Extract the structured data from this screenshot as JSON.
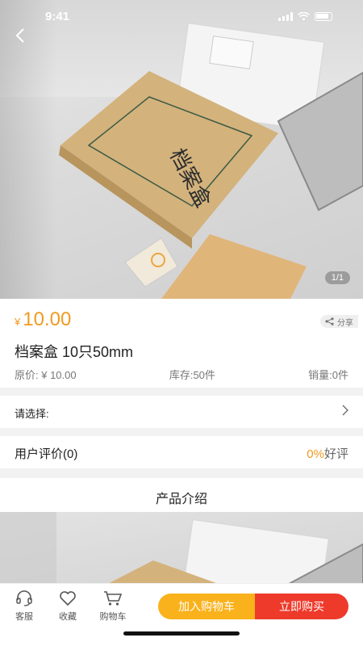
{
  "status_bar": {
    "time": "9:41"
  },
  "gallery": {
    "counter": "1/1",
    "box_label": "档案盒"
  },
  "product": {
    "currency": "¥",
    "price": "10.00",
    "share_label": "分享",
    "title": "档案盒 10只50mm",
    "original_price": "原价: ¥ 10.00",
    "stock": "库存:50件",
    "sales": "销量:0件"
  },
  "select": {
    "label": "请选择:"
  },
  "reviews": {
    "label": "用户评价(0)",
    "rate_value": "0%",
    "rate_suffix": "好评"
  },
  "intro": {
    "label": "产品介绍"
  },
  "bottom_bar": {
    "service": "客服",
    "favorite": "收藏",
    "cart": "购物车",
    "add_to_cart": "加入购物车",
    "buy_now": "立即购买"
  },
  "colors": {
    "accent": "#f19a1e",
    "cart_button": "#f9b21c",
    "buy_button": "#ee3a2b"
  }
}
